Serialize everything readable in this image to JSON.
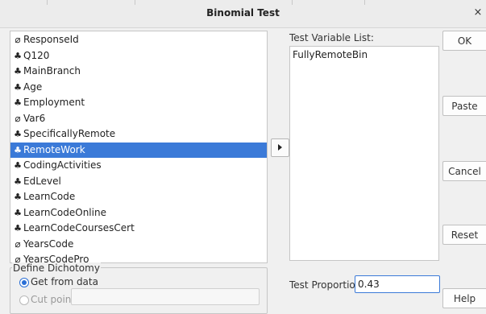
{
  "dialog": {
    "title": "Binomial Test",
    "close_glyph": "×"
  },
  "variables": [
    {
      "label": "ResponseId",
      "icon": "string-icon",
      "selected": false
    },
    {
      "label": "Q120",
      "icon": "nominal-icon",
      "selected": false
    },
    {
      "label": "MainBranch",
      "icon": "nominal-icon",
      "selected": false
    },
    {
      "label": "Age",
      "icon": "nominal-icon",
      "selected": false
    },
    {
      "label": "Employment",
      "icon": "nominal-icon",
      "selected": false
    },
    {
      "label": "Var6",
      "icon": "string-icon",
      "selected": false
    },
    {
      "label": "SpecificallyRemote",
      "icon": "nominal-icon",
      "selected": false
    },
    {
      "label": "RemoteWork",
      "icon": "nominal-icon",
      "selected": true
    },
    {
      "label": "CodingActivities",
      "icon": "nominal-icon",
      "selected": false
    },
    {
      "label": "EdLevel",
      "icon": "nominal-icon",
      "selected": false
    },
    {
      "label": "LearnCode",
      "icon": "nominal-icon",
      "selected": false
    },
    {
      "label": "LearnCodeOnline",
      "icon": "nominal-icon",
      "selected": false
    },
    {
      "label": "LearnCodeCoursesCert",
      "icon": "nominal-icon",
      "selected": false
    },
    {
      "label": "YearsCode",
      "icon": "string-icon",
      "selected": false
    },
    {
      "label": "YearsCodePro",
      "icon": "string-icon",
      "selected": false
    }
  ],
  "test_variable_list": {
    "label": "Test Variable List:",
    "items": [
      "FullyRemoteBin"
    ]
  },
  "buttons": {
    "ok": "OK",
    "paste": "Paste",
    "cancel": "Cancel",
    "reset": "Reset",
    "help": "Help"
  },
  "dichotomy": {
    "legend": "Define Dichotomy",
    "get_from_data": "Get from data",
    "cut_point": "Cut point:",
    "selected_option": "get_from_data",
    "cut_point_value": ""
  },
  "test_proportion": {
    "label": "Test Proportion:",
    "value": "0.43"
  },
  "colors": {
    "selection": "#3b7ad8",
    "radio_accent": "#2a6fd6"
  }
}
